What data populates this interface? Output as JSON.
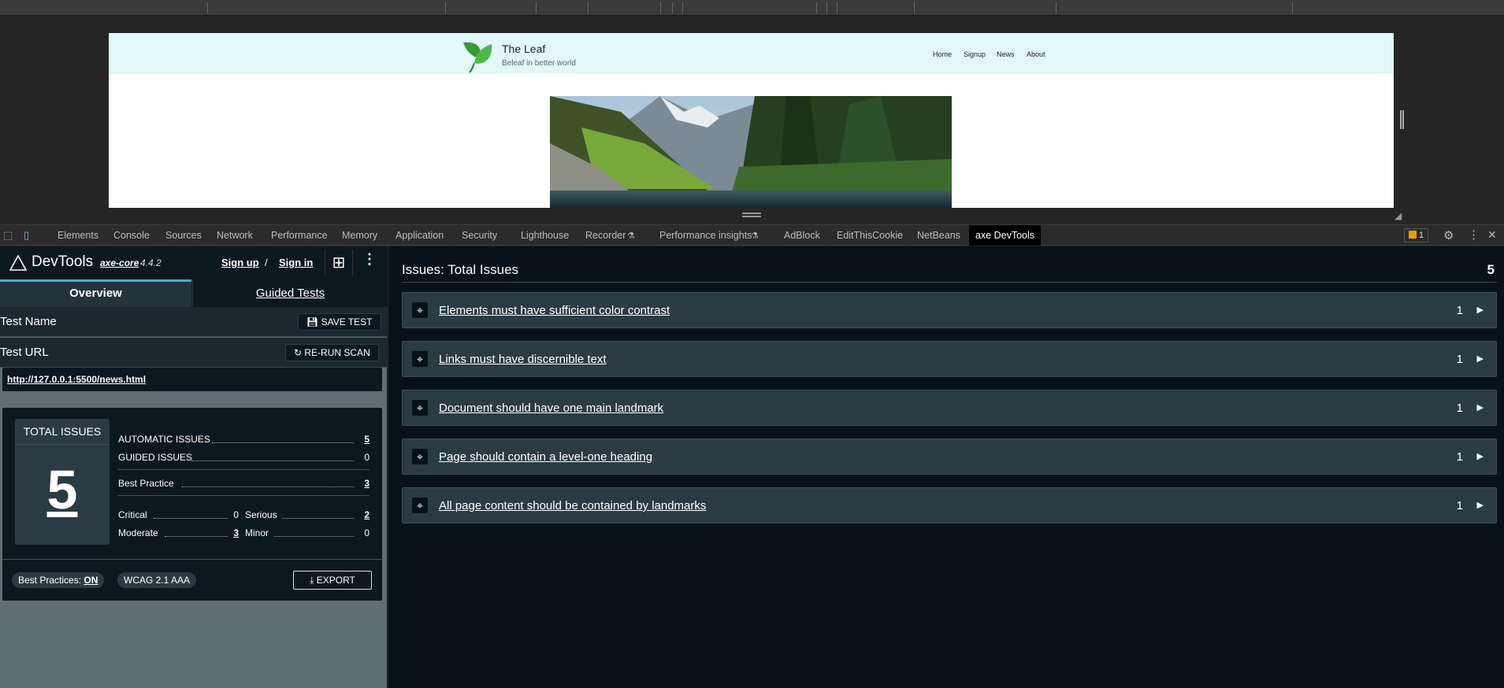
{
  "browser_page": {
    "brand_title": "The Leaf",
    "brand_tagline": "Beleaf in better world",
    "nav": [
      "Home",
      "Signup",
      "News",
      "About"
    ]
  },
  "devtools_tabs": [
    "Elements",
    "Console",
    "Sources",
    "Network",
    "Performance",
    "Memory",
    "Application",
    "Security",
    "Lighthouse",
    "Recorder",
    "Performance insights",
    "AdBlock",
    "EditThisCookie",
    "NetBeans",
    "axe DevTools"
  ],
  "issues_badge": "1",
  "axe": {
    "title": "DevTools",
    "axe_core_label": "axe-core",
    "version": "4.4.2",
    "sign_up": "Sign up",
    "separator": "/",
    "sign_in": "Sign in",
    "tabs": {
      "overview": "Overview",
      "guided": "Guided Tests"
    },
    "test_name_label": "Test Name",
    "save_test": "SAVE TEST",
    "test_url_label": "Test URL",
    "rerun_scan": "RE-RUN SCAN",
    "test_url": "http://127.0.0.1:5500/news.html",
    "summary": {
      "total_label": "TOTAL ISSUES",
      "total": "5",
      "automatic_label": "AUTOMATIC ISSUES",
      "automatic": "5",
      "guided_label": "GUIDED ISSUES",
      "guided": "0",
      "best_practice_label": "Best Practice",
      "best_practice": "3",
      "critical_label": "Critical",
      "critical": "0",
      "serious_label": "Serious",
      "serious": "2",
      "moderate_label": "Moderate",
      "moderate": "3",
      "minor_label": "Minor",
      "minor": "0"
    },
    "best_practices_label": "Best Practices:",
    "best_practices_value": "ON",
    "standard": "WCAG 2.1 AAA",
    "export": "EXPORT"
  },
  "issues": {
    "title": "Issues: Total Issues",
    "count": "5",
    "items": [
      {
        "title": "Elements must have sufficient color contrast",
        "count": "1"
      },
      {
        "title": "Links must have discernible text",
        "count": "1"
      },
      {
        "title": "Document should have one main landmark",
        "count": "1"
      },
      {
        "title": "Page should contain a level-one heading",
        "count": "1"
      },
      {
        "title": "All page content should be contained by landmarks",
        "count": "1"
      }
    ]
  }
}
